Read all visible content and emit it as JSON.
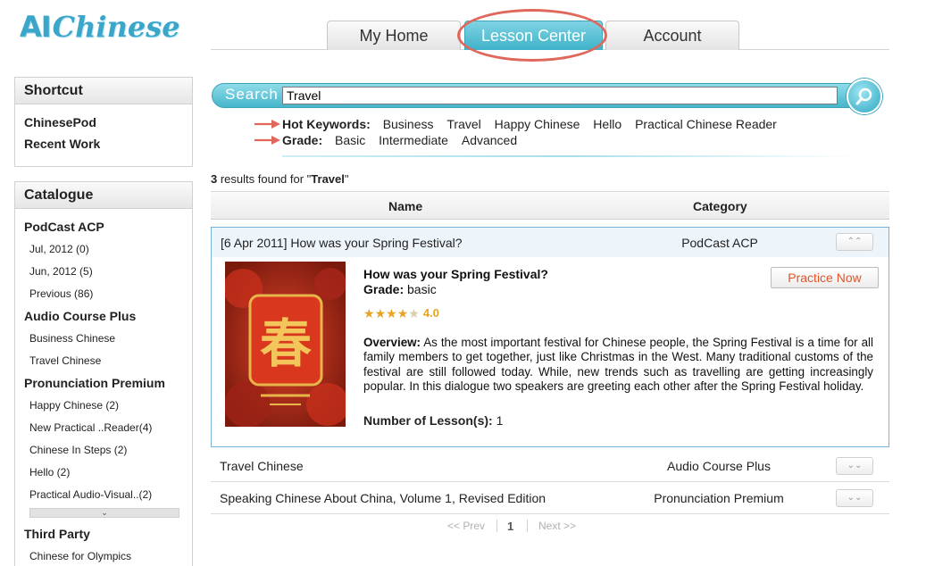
{
  "app": {
    "logo_ai": "AI",
    "logo_chinese": "Chinese"
  },
  "nav": {
    "tabs": [
      {
        "label": "My Home"
      },
      {
        "label": "Lesson Center",
        "active": true
      },
      {
        "label": "Account"
      }
    ]
  },
  "sidebar": {
    "shortcut": {
      "title": "Shortcut",
      "items": [
        "ChinesePod",
        "Recent Work"
      ]
    },
    "catalogue": {
      "title": "Catalogue",
      "groups": [
        {
          "name": "PodCast ACP",
          "items": [
            "Jul, 2012 (0)",
            "Jun, 2012 (5)",
            "Previous (86)"
          ]
        },
        {
          "name": "Audio Course Plus",
          "items": [
            "Business Chinese",
            "Travel Chinese"
          ]
        },
        {
          "name": "Pronunciation Premium",
          "items": [
            "Happy Chinese (2)",
            "New Practical ..Reader(4)",
            "Chinese In Steps (2)",
            "Hello (2)",
            "Practical Audio-Visual..(2)"
          ]
        },
        {
          "name": "Third Party",
          "items": [
            "Chinese for Olympics"
          ]
        }
      ]
    }
  },
  "search": {
    "label": "Search",
    "value": "Travel",
    "hot_keywords_label": "Hot Keywords:",
    "hot_keywords": [
      "Business",
      "Travel",
      "Happy Chinese",
      "Hello",
      "Practical Chinese Reader"
    ],
    "grade_label": "Grade:",
    "grades": [
      "Basic",
      "Intermediate",
      "Advanced"
    ]
  },
  "results": {
    "count": "3",
    "text_mid": " results found for \"",
    "query": "Travel",
    "text_end": "\"",
    "columns": {
      "name": "Name",
      "category": "Category"
    },
    "rows": [
      {
        "name": "[6 Apr 2011] How was your Spring Festival?",
        "category": "PodCast ACP",
        "expanded": true
      },
      {
        "name": "Travel Chinese",
        "category": "Audio Course Plus",
        "expanded": false
      },
      {
        "name": "Speaking Chinese About China, Volume 1, Revised Edition",
        "category": "Pronunciation Premium",
        "expanded": false
      }
    ],
    "detail": {
      "title": "How was your Spring Festival?",
      "grade_label": "Grade:",
      "grade_value": "basic",
      "rating": "4.0",
      "stars": 4,
      "practice_label": "Practice Now",
      "overview_label": "Overview:",
      "overview_text": "As the most important festival for Chinese people, the Spring Festival is a time for all family members to get together, just like Christmas in the West. Many traditional customs of the festival are still followed today. While, new trends such as travelling are getting increasingly popular. In this dialogue two speakers are greeting each other after the Spring Festival holiday.",
      "lessons_label": "Number of Lesson(s):",
      "lessons_value": "1",
      "thumb_char": "春"
    }
  },
  "pagination": {
    "prev": "<< Prev",
    "current": "1",
    "next": "Next >>"
  },
  "colors": {
    "accent": "#3fb2c9",
    "highlight": "#e0675b",
    "practice": "#e0562c",
    "star": "#e7a323"
  },
  "icons": [
    "search-icon",
    "arrow-right-icon",
    "chevron-up-icon",
    "chevron-down-icon",
    "star-icon"
  ]
}
